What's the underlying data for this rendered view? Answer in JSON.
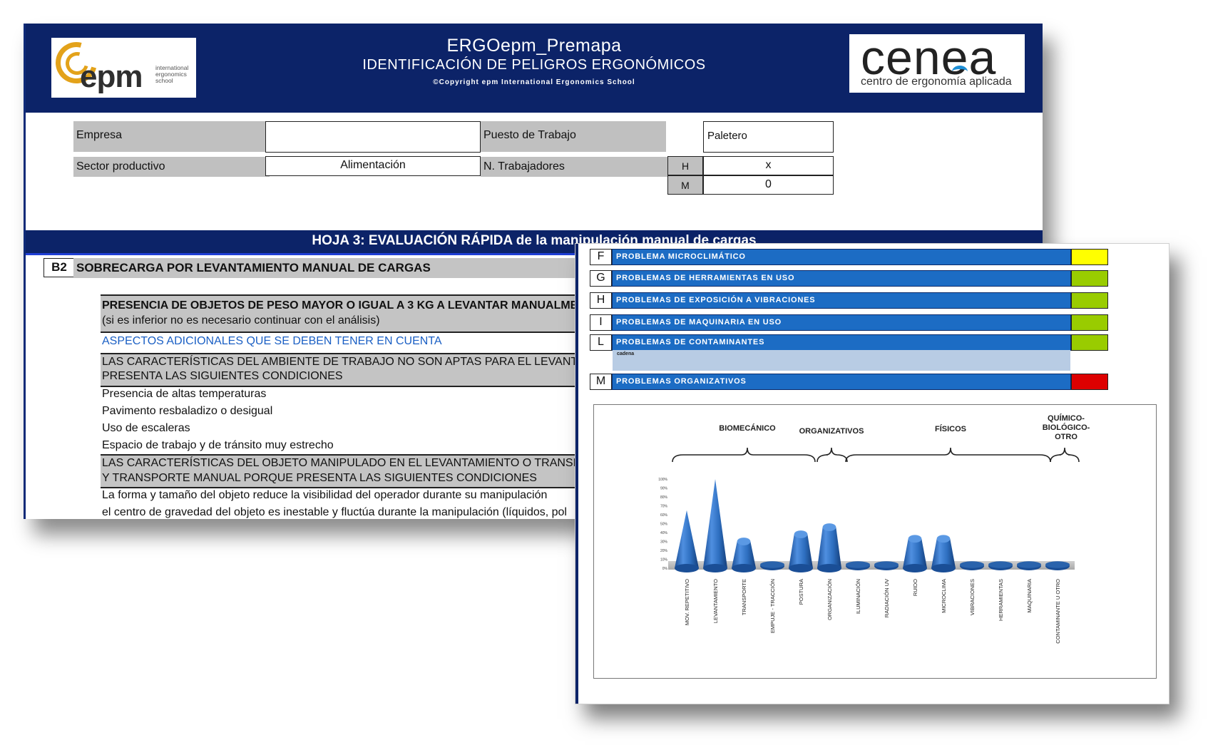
{
  "header": {
    "title": "ERGOepm_Premapa",
    "subtitle": "IDENTIFICACIÓN DE PELIGROS ERGONÓMICOS",
    "copyright": "©Copyright epm International Ergonomics School",
    "epm_logo": {
      "word": "epm",
      "tagline": "international ergonomics school"
    },
    "cenea_logo": {
      "word": "cenea",
      "tagline": "centro de ergonomía aplicada"
    }
  },
  "form": {
    "empresa_label": "Empresa",
    "empresa_value": "",
    "puesto_label": "Puesto de Trabajo",
    "puesto_value": "Paletero",
    "sector_label": "Sector productivo",
    "sector_value": "Alimentación",
    "trabajadores_label": "N. Trabajadores",
    "h_label": "H",
    "h_value": "x",
    "m_label": "M",
    "m_value": "0"
  },
  "hoja_title": "HOJA 3: EVALUACIÓN RÁPIDA de la manipulación manual de cargas",
  "section": {
    "code": "B2",
    "title": "SOBRECARGA POR LEVANTAMIENTO MANUAL DE CARGAS"
  },
  "rows": {
    "presencia_title": "PRESENCIA DE OBJETOS DE PESO MAYOR O IGUAL A 3 KG A LEVANTAR MANUALME",
    "presencia_note": "(si es inferior no es necesario continuar con el análisis)",
    "aspectos": "ASPECTOS ADICIONALES QUE SE DEBEN TENER EN CUENTA",
    "ambiente_1": "LAS CARACTERÍSTICAS DEL AMBIENTE DE TRABAJO NO SON APTAS PARA EL LEVANTA",
    "ambiente_2": "PRESENTA LAS SIGUIENTES CONDICIONES",
    "item_1": "Presencia de altas temperaturas",
    "item_2": "Pavimento resbaladizo o desigual",
    "item_3": "Uso de escaleras",
    "item_4": "Espacio de trabajo y de tránsito muy estrecho",
    "objeto_1": "LAS CARACTERÍSTICAS DEL OBJETO MANIPULADO EN EL LEVANTAMIENTO O TRANSPOR",
    "objeto_2": "Y TRANSPORTE MANUAL PORQUE PRESENTA LAS SIGUIENTES CONDICIONES",
    "item_5": "La forma y tamaño del objeto reduce la visibilidad del operador durante su manipulación",
    "item_6": "el centro de gravedad del objeto es inestable y fluctúa durante la manipulación (líquidos, pol"
  },
  "problems": [
    {
      "letter": "F",
      "label": "PROBLEMA MICROCLIMÁTICO",
      "status_color": "#ffff00"
    },
    {
      "letter": "G",
      "label": "PROBLEMAS DE HERRAMIENTAS EN USO",
      "status_color": "#99cc00"
    },
    {
      "letter": "H",
      "label": "PROBLEMAS DE EXPOSICIÓN A VIBRACIONES",
      "status_color": "#99cc00"
    },
    {
      "letter": "I",
      "label": "PROBLEMAS DE MAQUINARIA EN USO",
      "status_color": "#99cc00"
    },
    {
      "letter": "L",
      "label": "PROBLEMAS DE CONTAMINANTES",
      "status_color": "#99cc00"
    },
    {
      "letter": "M",
      "label": "PROBLEMAS ORGANIZATIVOS",
      "status_color": "#dd0000"
    }
  ],
  "cadena_label": "cadena",
  "chart_data": {
    "type": "bar",
    "shape": "cone",
    "groups": [
      {
        "label": "BIOMECÁNICO"
      },
      {
        "label": "ORGANIZATIVOS"
      },
      {
        "label": "FÍSICOS"
      },
      {
        "label": "QUÍMICO-BIOLÓGICO-OTRO"
      }
    ],
    "categories": [
      "MOV. REPETITIVO",
      "LEVANTAMIENTO",
      "TRANSPORTE",
      "EMPUJE - TRACCIÓN",
      "POSTURA",
      "ORGANIZACIÓN",
      "ILUMINACIÓN",
      "RADIACIÓN UV",
      "RUIDO",
      "MICROCLIMA",
      "VIBRACIONES",
      "HERRAMIENTAS",
      "MAQUINARIA",
      "CONTAMINANTE U OTRO"
    ],
    "values": [
      65,
      100,
      30,
      0,
      38,
      46,
      0,
      0,
      33,
      33,
      0,
      0,
      0,
      0
    ],
    "ylim": [
      0,
      100
    ],
    "yticks": [
      "0%",
      "10%",
      "20%",
      "30%",
      "40%",
      "50%",
      "60%",
      "70%",
      "80%",
      "90%",
      "100%"
    ],
    "color": "#2e6fc0"
  }
}
